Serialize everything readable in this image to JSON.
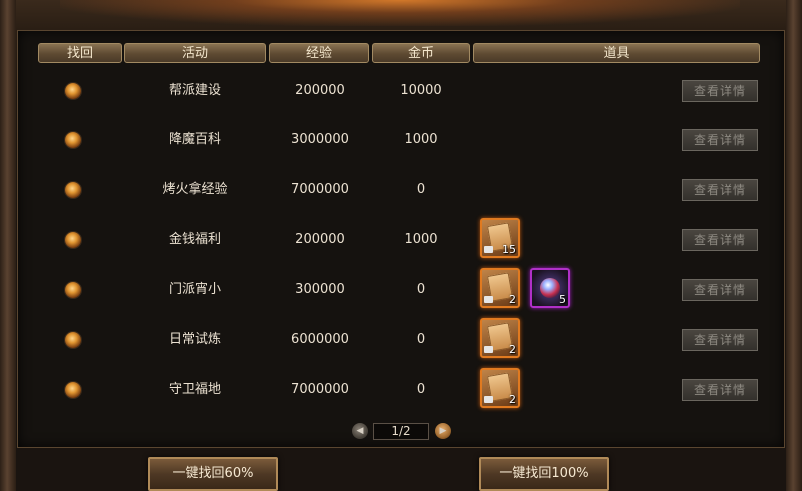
{
  "headers": {
    "recover": "找回",
    "activity": "活动",
    "exp": "经验",
    "gold": "金币",
    "items": "道具"
  },
  "rows": [
    {
      "activity": "帮派建设",
      "exp": "200000",
      "gold": "10000",
      "items": [],
      "detail": "查看详情"
    },
    {
      "activity": "降魔百科",
      "exp": "3000000",
      "gold": "1000",
      "items": [],
      "detail": "查看详情"
    },
    {
      "activity": "烤火拿经验",
      "exp": "7000000",
      "gold": "0",
      "items": [],
      "detail": "查看详情"
    },
    {
      "activity": "金钱福利",
      "exp": "200000",
      "gold": "1000",
      "items": [
        {
          "icon": "scroll-icon",
          "count": "15",
          "rarity": "orange"
        }
      ],
      "detail": "查看详情"
    },
    {
      "activity": "门派宵小",
      "exp": "300000",
      "gold": "0",
      "items": [
        {
          "icon": "scroll-icon",
          "count": "2",
          "rarity": "orange"
        },
        {
          "icon": "gem-icon",
          "count": "5",
          "rarity": "purple"
        }
      ],
      "detail": "查看详情"
    },
    {
      "activity": "日常试炼",
      "exp": "6000000",
      "gold": "0",
      "items": [
        {
          "icon": "scroll-icon",
          "count": "2",
          "rarity": "orange"
        }
      ],
      "detail": "查看详情"
    },
    {
      "activity": "守卫福地",
      "exp": "7000000",
      "gold": "0",
      "items": [
        {
          "icon": "scroll-icon",
          "count": "2",
          "rarity": "orange"
        }
      ],
      "detail": "查看详情"
    }
  ],
  "pager": {
    "text": "1/2"
  },
  "buttons": {
    "recover60": "一键找回60%",
    "recover100": "一键找回100%"
  }
}
